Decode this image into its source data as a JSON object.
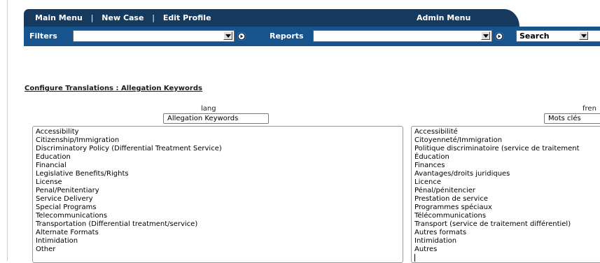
{
  "nav": {
    "items": [
      "Main Menu",
      "New Case",
      "Edit Profile"
    ],
    "separator": "|",
    "admin_menu": "Admin Menu"
  },
  "toolbar": {
    "filters_label": "Filters",
    "filters_value": "",
    "reports_label": "Reports",
    "reports_value": "",
    "search_value": "Search"
  },
  "page": {
    "title": "Configure Translations : Allegation Keywords"
  },
  "lang_column": {
    "header": "lang",
    "name_value": "Allegation Keywords",
    "keywords": [
      "Accessibility",
      "Citizenship/Immigration",
      "Discriminatory Policy (Differential Treatment Service)",
      "Education",
      "Financial",
      "Legislative Benefits/Rights",
      "License",
      "Penal/Penitentiary",
      "Service Delivery",
      "Special Programs",
      "Telecommunications",
      "Transportation (Differential treatment/service)",
      "Alternate Formats",
      "Intimidation",
      "Other"
    ]
  },
  "french_column": {
    "header": "fren",
    "name_value": "Mots clés",
    "keywords": [
      "Accessibilité",
      "Citoyenneté/Immigration",
      "Politique discriminatoire (service de traitement",
      "Éducation",
      "Finances",
      "Avantages/droits juridiques",
      "Licence",
      "Pénal/pénitencier",
      "Prestation de service",
      "Programmes spéciaux",
      "Télécommunications",
      "Transport (service de traitement différentiel)",
      "Autres formats",
      "Intimidation",
      "Autres"
    ]
  },
  "icons": {
    "dropdown": "chevron-down-icon",
    "go": "play-circle-icon"
  },
  "colors": {
    "nav_dark": "#163a5e",
    "toolbar_blue": "#17548e"
  }
}
